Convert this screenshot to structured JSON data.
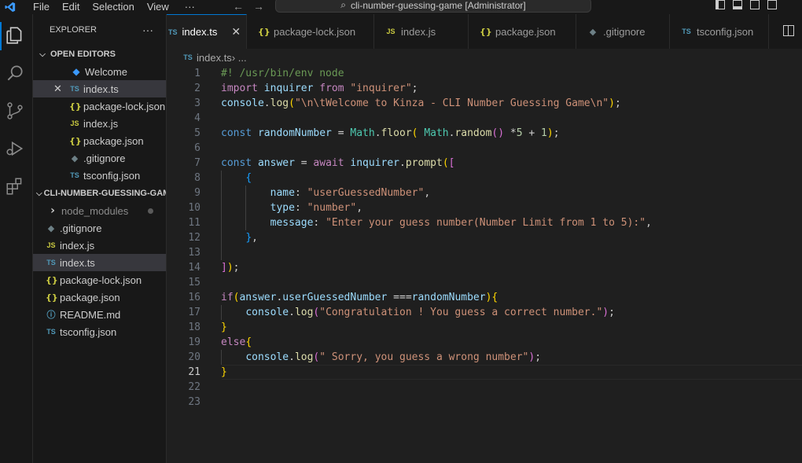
{
  "titlebar": {
    "menu": [
      "File",
      "Edit",
      "Selection",
      "View",
      "···"
    ],
    "window_title": "cli-number-guessing-game [Administrator]"
  },
  "explorer": {
    "title": "EXPLORER",
    "more": "···",
    "open_editors_label": "OPEN EDITORS",
    "open_editors": [
      {
        "name": "Welcome",
        "icon": "vscode-icon"
      },
      {
        "name": "index.ts",
        "icon": "TS"
      },
      {
        "name": "package-lock.json",
        "icon": "{}"
      },
      {
        "name": "index.js",
        "icon": "JS"
      },
      {
        "name": "package.json",
        "icon": "{}"
      },
      {
        "name": ".gitignore",
        "icon": "◆"
      },
      {
        "name": "tsconfig.json",
        "icon": "TS"
      }
    ],
    "project_label": "CLI-NUMBER-GUESSING-GAME",
    "files": [
      {
        "name": "node_modules",
        "icon": "›"
      },
      {
        "name": ".gitignore",
        "icon": "◆"
      },
      {
        "name": "index.js",
        "icon": "JS"
      },
      {
        "name": "index.ts",
        "icon": "TS"
      },
      {
        "name": "package-lock.json",
        "icon": "{}"
      },
      {
        "name": "package.json",
        "icon": "{}"
      },
      {
        "name": "README.md",
        "icon": "ⓘ"
      },
      {
        "name": "tsconfig.json",
        "icon": "TS"
      }
    ]
  },
  "tabs": [
    {
      "name": "index.ts",
      "icon": "TS",
      "close": "✕"
    },
    {
      "name": "package-lock.json",
      "icon": "{}"
    },
    {
      "name": "index.js",
      "icon": "JS"
    },
    {
      "name": "package.json",
      "icon": "{}"
    },
    {
      "name": ".gitignore",
      "icon": "◆"
    },
    {
      "name": "tsconfig.json",
      "icon": "TS"
    }
  ],
  "breadcrumb": {
    "icon": "TS",
    "file": "index.ts",
    "sep": " › ...",
    "label": "index.ts › ..."
  },
  "code": {
    "line_numbers": [
      "1",
      "2",
      "3",
      "4",
      "5",
      "6",
      "7",
      "8",
      "9",
      "10",
      "11",
      "12",
      "13",
      "14",
      "15",
      "16",
      "17",
      "18",
      "19",
      "20",
      "21",
      "22",
      "23"
    ],
    "l1": "#! /usr/bin/env node",
    "l2_import": "import",
    "l2_inquirer": "inquirer",
    "l2_from": "from",
    "l2_str": "\"inquirer\"",
    "l2_semi": ";",
    "l3_console": "console",
    "l3_log": "log",
    "l3_str": "\"\\n\\tWelcome to Kinza - CLI Number Guessing Game\\n\"",
    "l5_const": "const",
    "l5_var": "randomNumber",
    "l5_eq": " = ",
    "l5_math": "Math",
    "l5_floor": "floor",
    "l5_random": "random",
    "l5_five": "5",
    "l5_one": "1",
    "l7_const": "const",
    "l7_answer": "answer",
    "l7_await": "await",
    "l7_prompt": "prompt",
    "l9_name": "name",
    "l9_str": "\"userGuessedNumber\"",
    "l10_type": "type",
    "l10_str": "\"number\"",
    "l11_message": "message",
    "l11_str": "\"Enter your guess number(Number Limit from 1 to 5):\"",
    "l16_if": "if",
    "l16_prop": "userGuessedNumber",
    "l16_op": " ===",
    "l17_str": "\"Congratulation ! You guess a correct number.\"",
    "l19_else": "else",
    "l20_str": "\" Sorry, you guess a wrong number\""
  }
}
